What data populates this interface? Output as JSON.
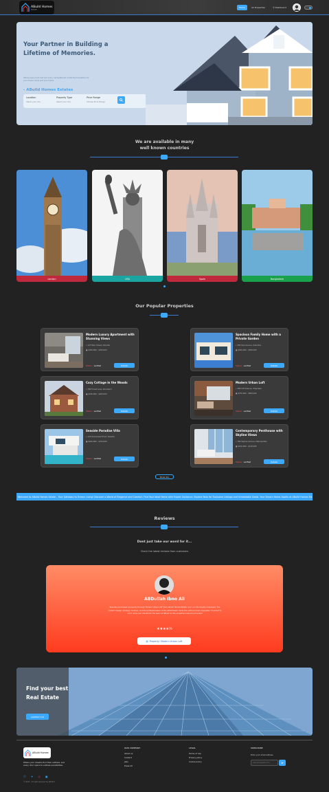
{
  "nav": {
    "logo_text": "ABuild Homes",
    "logo_sub": "ESTATE",
    "links": [
      "Home",
      "All Properties",
      "Dashboard"
    ]
  },
  "hero": {
    "title": "Your Partner in Building a Lifetime of Memories.",
    "brand": "- ABuild Homes Estates",
    "description": "Where every brick laid and every nail tightened, builds the foundation for your dream home and your future.",
    "search": {
      "location_label": "Location",
      "location_value": "Select your city",
      "type_label": "Property Type",
      "type_value": "Select your city",
      "price_label": "Price Range",
      "price_value": "Choose Price Range"
    }
  },
  "countries": {
    "heading_line1": "We are available in many",
    "heading_line2": "well known countries",
    "items": [
      {
        "name": "London",
        "color": "#c0283c"
      },
      {
        "name": "USA",
        "color": "#1aa5a0"
      },
      {
        "name": "Spain",
        "color": "#c0283c"
      },
      {
        "name": "Bangladesh",
        "color": "#19a24b"
      }
    ]
  },
  "properties": {
    "heading": "Our Popular Properties",
    "status_word": "Status :",
    "verified": "verified",
    "details": "Details",
    "show_all": "Show ALL",
    "items": [
      {
        "title": "Modern Luxury Apartment with Stunning Views",
        "address": "123 Main Street, Cityville",
        "price": "$300,000 - $350,000"
      },
      {
        "title": "Spacious Family Home with a Private Garden",
        "address": "456 Oak Avenue, Suburbia",
        "price": "$500,000 - $550,000"
      },
      {
        "title": "Cozy Cottage in the Woods",
        "address": "789 Forest Lane, Woodland",
        "price": "$180,000 - $200,000"
      },
      {
        "title": "Modern Urban Loft",
        "address": "456 Loft Avenue, Cityscape",
        "price": "$750,000 - $850,000"
      },
      {
        "title": "Seaside Paradise Villa",
        "address": "123 Oceanview Drive, Seaside",
        "price": "$400,000 - $700,000"
      },
      {
        "title": "Contemporary Penthouse with Skyline Views",
        "address": "789 Skyline Avenue, Metropolitan",
        "price": "$100,000 - $130,000"
      }
    ]
  },
  "marquee": "Welcome to ABuild Homes Estate – Your Gateway to Dream Living! Discover a World of Elegance and Comfort. Find Your Ideal Home with Expert Guidance. Explore Now for Exclusive Listings and Unbeatable Deals. Your Dream Home Awaits at ABuild Homes Estate!",
  "reviews": {
    "heading": "Reviews",
    "sub_heading": "Dont just take our word for it...",
    "sub_text": "Check the latest reviews from customers",
    "name": "ABDullah Ibno Ali",
    "text": "Recently purchased a property through 'Modern Urban Loft' from ABuild Homes Estate, and I am thoroughly impressed. The modern design, strategic location, and the professionalism of the ABuild team made the entire process enjoyable. I'm proud to call it home and thankful to the team at ABuild for the exceptional service provided!",
    "stars": "★★★★½",
    "property_badge": "Property: Modern Urban Loft"
  },
  "cta": {
    "title": "Find your best Real Estate",
    "button": "CONTACT US"
  },
  "footer": {
    "tagline": "Where your dreams find their address, and every door opens to endless possibilities.",
    "copyright": "© 2024 - All right reserved by ABUILD",
    "company_heading": "OUR COMPANY",
    "company_links": [
      "About us",
      "Contact",
      "Jobs",
      "Press kit"
    ],
    "legal_heading": "LEGAL",
    "legal_links": [
      "Terms of use",
      "Privacy policy",
      "Cookie policy"
    ],
    "subscribe_heading": "SUBSCRIBE",
    "subscribe_label": "Enter your email address",
    "subscribe_placeholder": "username@site.com"
  },
  "colors": {
    "accent": "#3da9fc",
    "background": "#222222",
    "verified": "#ff4d4d"
  }
}
